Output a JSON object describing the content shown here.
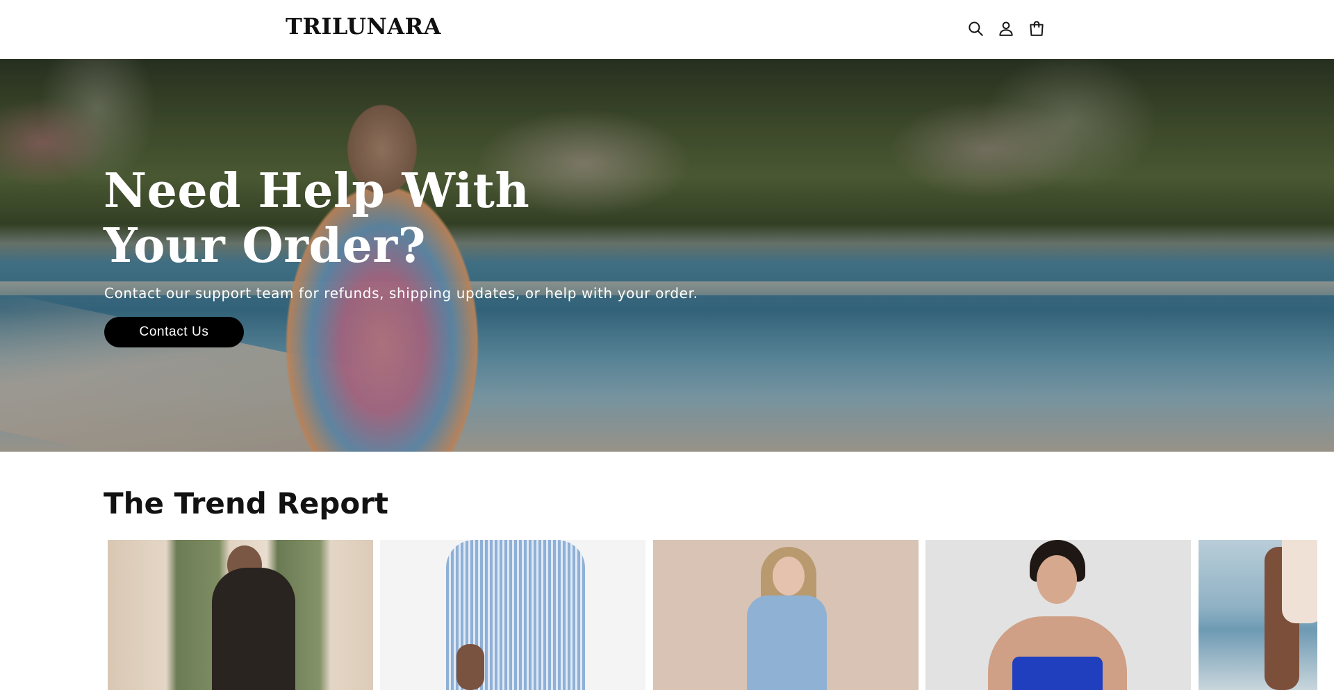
{
  "header": {
    "logo_text": "TRILUNARA",
    "icons": [
      "search-icon",
      "account-icon",
      "cart-icon"
    ]
  },
  "hero": {
    "title_line1": "Need Help With",
    "title_line2": "Your Order?",
    "subtitle": "Contact our support team for refunds, shipping updates, or help with your order.",
    "button_label": "Contact Us"
  },
  "trend": {
    "title": "The Trend Report",
    "cards": [
      {
        "image": "product-photo"
      },
      {
        "image": "product-photo"
      },
      {
        "image": "product-photo"
      },
      {
        "image": "product-photo"
      },
      {
        "image": "product-photo"
      }
    ]
  },
  "colors": {
    "button_bg": "#000000",
    "text_primary": "#121212",
    "hero_text": "#ffffff"
  }
}
